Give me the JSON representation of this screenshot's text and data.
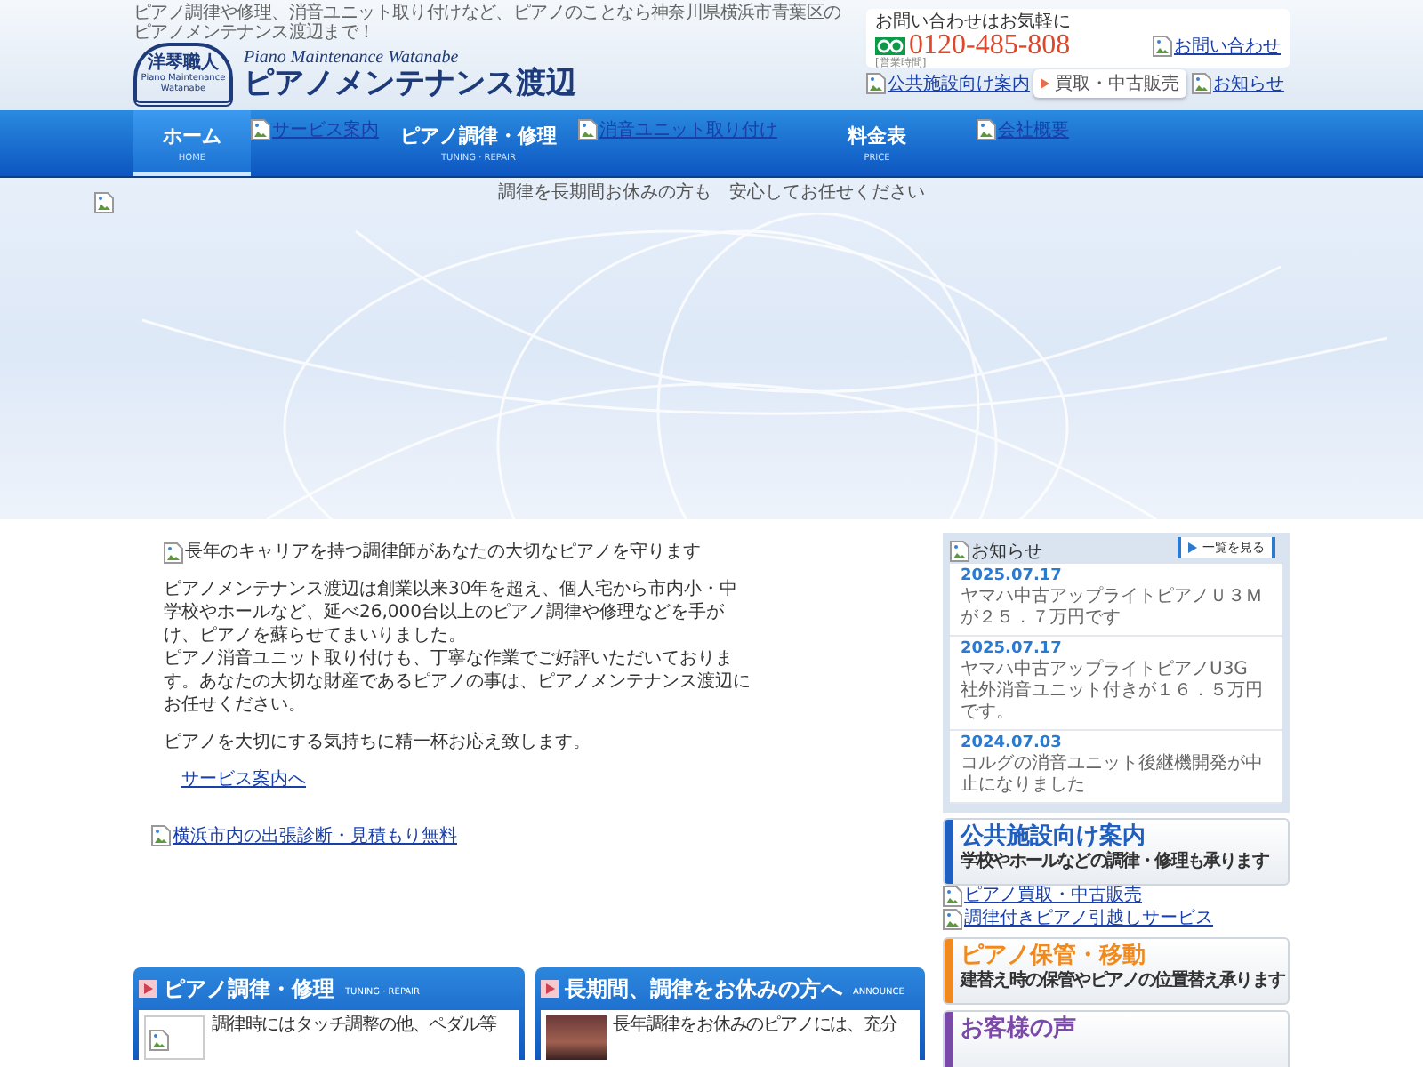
{
  "tagline": "ピアノ調律や修理、消音ユニット取り付けなど、ピアノのことなら神奈川県横浜市青葉区のピアノメンテナンス渡辺まで！",
  "logo": {
    "emblem": "洋琴職人",
    "emblem_sub": "Piano Maintenance Watanabe",
    "subtitle": "Piano Maintenance Watanabe",
    "title": "ピアノメンテナンス渡辺"
  },
  "contact": {
    "label": "お問い合わせはお気軽に",
    "phone": "0120-485-808",
    "hours": "[営業時間]",
    "link": "お問い合わせ"
  },
  "header_links": [
    {
      "kind": "image-link",
      "text": "公共施設向け案内"
    },
    {
      "kind": "button",
      "text": "買取・中古販売"
    },
    {
      "kind": "image-link",
      "text": "お知らせ"
    }
  ],
  "nav": [
    {
      "kind": "tab",
      "label": "ホーム",
      "sub": "HOME",
      "selected": true
    },
    {
      "kind": "image-link",
      "text": "サービス案内"
    },
    {
      "kind": "tab",
      "label": "ピアノ調律・修理",
      "sub": "TUNING · REPAIR",
      "selected": false
    },
    {
      "kind": "image-link",
      "text": "消音ユニット取り付け"
    },
    {
      "kind": "tab",
      "label": "料金表",
      "sub": "PRICE",
      "selected": false
    },
    {
      "kind": "image-link",
      "text": "会社概要"
    }
  ],
  "hero": {
    "caption": "調律を長期間お休みの方も　安心してお任せください"
  },
  "intro": {
    "heading": "長年のキャリアを持つ調律師があなたの大切なピアノを守ります",
    "paragraphs": [
      [
        "ピアノメンテナンス渡辺は創業以来30年を超え、個人宅から市内小・中学校やホールなど、延べ26,000台以上のピアノ調律や修理などを手がけ、ピアノを蘇らせてまいりました。",
        "ピアノ消音ユニット取り付けも、丁寧な作業でご好評いただいております。あなたの大切な財産であるピアノの事は、ピアノメンテナンス渡辺にお任せください。"
      ],
      [
        "ピアノを大切にする気持ちに精一杯お応え致します。"
      ]
    ],
    "link": "サービス案内へ",
    "banner_link": "横浜市内の出張診断・見積もり無料"
  },
  "cards": [
    {
      "kind": "broken-image",
      "title": "ピアノ調律・修理",
      "sub": "TUNING · REPAIR",
      "text": "調律時にはタッチ調整の他、ペダル等"
    },
    {
      "kind": "photo",
      "title": "長期間、調律をお休みの方へ",
      "sub": "ANNOUNCE",
      "text": "長年調律をお休みのピアノには、充分"
    }
  ],
  "news": {
    "title": "お知らせ",
    "more": "一覧を見る",
    "items": [
      {
        "date": "2025.07.17",
        "text": "ヤマハ中古アップライトピアノＵ３Ｍが２５．７万円です"
      },
      {
        "date": "2025.07.17",
        "text": "ヤマハ中古アップライトピアノU3G　社外消音ユニット付きが１６．５万円です。"
      },
      {
        "date": "2024.07.03",
        "text": "コルグの消音ユニット後継機開発が中止になりました"
      }
    ]
  },
  "promos": [
    {
      "kind": "banner",
      "title": "公共施設向け案内",
      "sub": "学校やホールなどの調律・修理も承ります",
      "color": "#1f5fbf"
    },
    {
      "kind": "link",
      "text": "ピアノ買取・中古販売"
    },
    {
      "kind": "link",
      "text": "調律付きピアノ引越しサービス"
    },
    {
      "kind": "banner",
      "title": "ピアノ保管・移動",
      "sub": "建替え時の保管やピアノの位置替え承ります",
      "color": "#f08a1e"
    },
    {
      "kind": "banner",
      "title": "お客様の声",
      "color": "#7b4aa8"
    }
  ]
}
